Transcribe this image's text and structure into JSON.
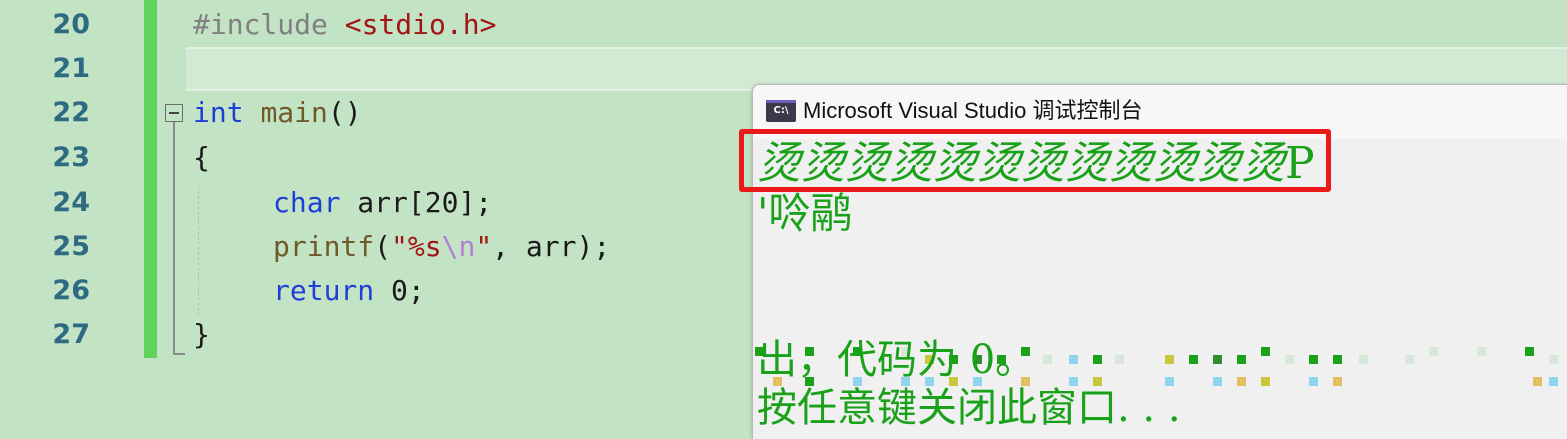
{
  "editor": {
    "line_numbers": [
      "20",
      "21",
      "22",
      "23",
      "24",
      "25",
      "26",
      "27"
    ],
    "lines": {
      "l20": {
        "directive": "#include",
        "header": "<stdio.h>"
      },
      "l22": {
        "kw": "int",
        "fn": "main",
        "rest": "()"
      },
      "l23": {
        "text": "{"
      },
      "l24": {
        "kw": "char",
        "rest": " arr[20];"
      },
      "l25": {
        "fn": "printf",
        "open": "(",
        "str1": "\"%s",
        "esc": "\\n",
        "str2": "\"",
        "rest": ", arr);"
      },
      "l26": {
        "kw": "return",
        "rest": " 0;"
      },
      "l27": {
        "text": "}"
      }
    },
    "colors": {
      "background": "#c3e3c5",
      "keyword": "#1f3fd6",
      "line_number": "#2e6b83",
      "change_bar": "#5fd35a"
    },
    "icons": {
      "fold": "collapse-minus-icon"
    }
  },
  "console": {
    "title": "Microsoft Visual Studio 调试控制台",
    "icon": "console-app-icon",
    "icon_label": "C:\\",
    "output": {
      "line1_highlighted": "烫烫烫烫烫烫烫烫烫烫烫烫",
      "line1_tail": "P",
      "line2": "'唥鹝",
      "line4": "出，代码为 0。",
      "line5": "按任意键关闭此窗口. . ."
    },
    "colors": {
      "output_text": "#1aa11a",
      "highlight_border": "#ea1a1a",
      "background": "#f0f0f0"
    }
  }
}
